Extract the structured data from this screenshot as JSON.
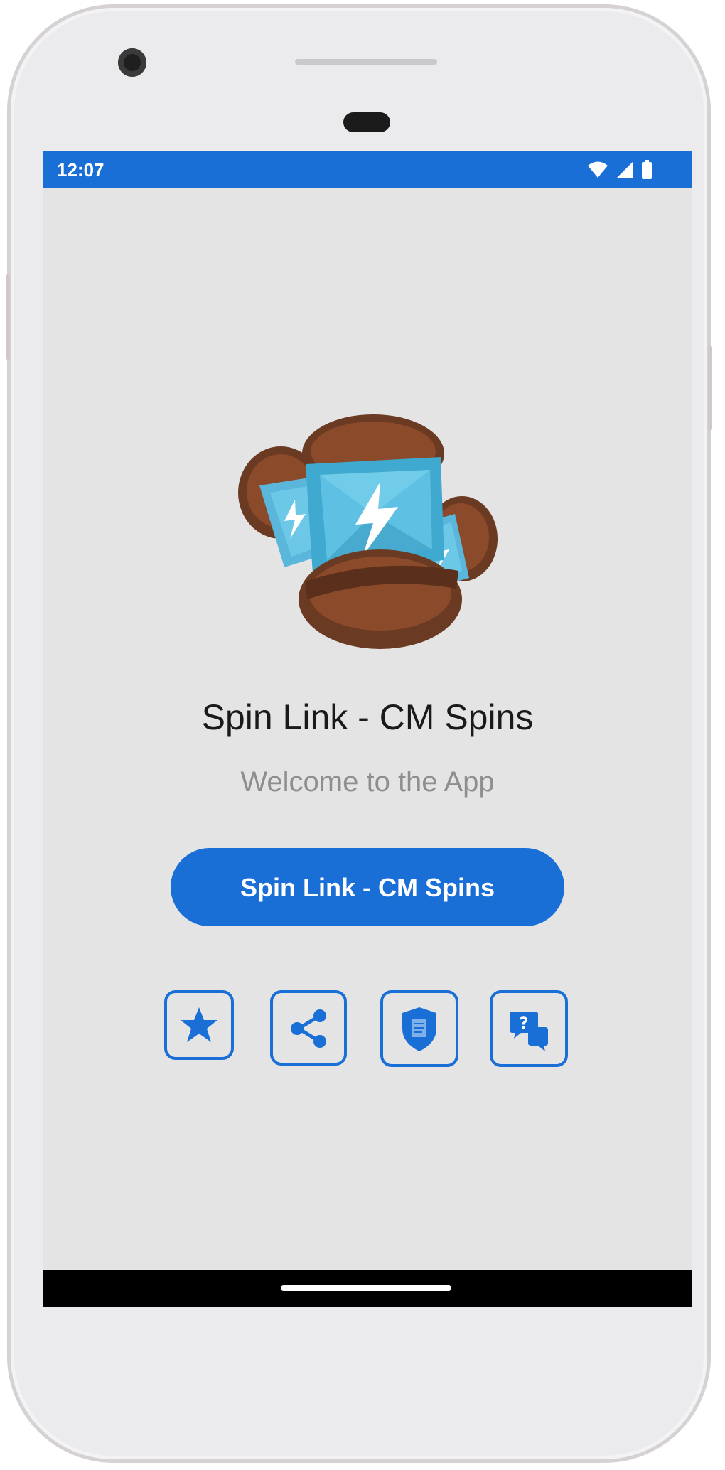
{
  "status_bar": {
    "time": "12:07",
    "color": "#1a6fd6",
    "icons": [
      "wifi-icon",
      "signal-icon",
      "battery-icon"
    ]
  },
  "app": {
    "logo": "coin-spin-logo",
    "title": "Spin Link - CM Spins",
    "subtitle": "Welcome to the App",
    "primary_button_label": "Spin Link - CM Spins",
    "accent_color": "#1a6fd6"
  },
  "actions": [
    {
      "name": "rate-button",
      "icon": "star-icon"
    },
    {
      "name": "share-button",
      "icon": "share-icon"
    },
    {
      "name": "privacy-policy-button",
      "icon": "shield-document-icon"
    },
    {
      "name": "contact-button",
      "icon": "chat-icon"
    }
  ],
  "navigation_bar": {
    "home_indicator": "home-indicator"
  }
}
